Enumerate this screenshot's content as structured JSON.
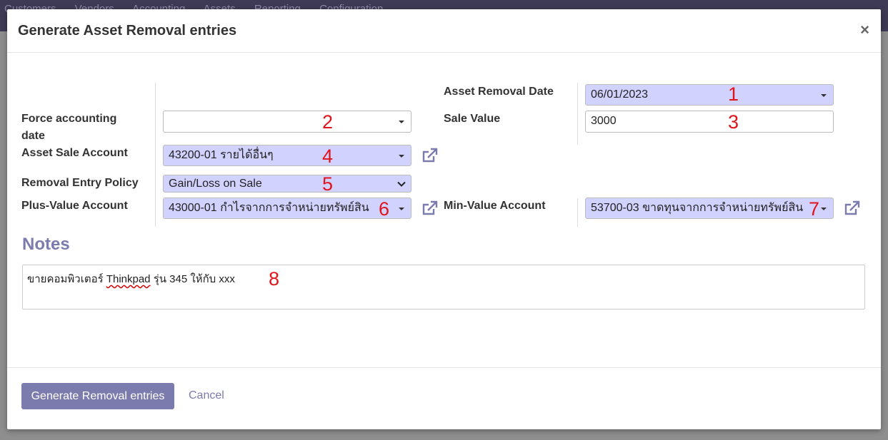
{
  "background": {
    "nav_items": [
      "Customers",
      "Vendors",
      "Accounting",
      "Assets",
      "Reporting",
      "Configuration"
    ]
  },
  "dialog": {
    "title": "Generate Asset Removal entries",
    "close_glyph": "×",
    "fields": {
      "asset_removal_date": {
        "label": "Asset Removal Date",
        "value": "06/01/2023",
        "marker": "1"
      },
      "force_accounting_date": {
        "label": "Force accounting date",
        "value": "",
        "marker": "2"
      },
      "sale_value": {
        "label": "Sale Value",
        "value": "3000",
        "marker": "3"
      },
      "asset_sale_account": {
        "label": "Asset Sale Account",
        "value": "43200-01 รายได้อื่นๆ",
        "marker": "4"
      },
      "removal_entry_policy": {
        "label": "Removal Entry Policy",
        "value": "Gain/Loss on Sale",
        "marker": "5"
      },
      "plus_value_account": {
        "label": "Plus-Value Account",
        "value": "43000-01 กำไรจากการจำหน่ายทรัพย์สิน",
        "marker": "6"
      },
      "min_value_account": {
        "label": "Min-Value Account",
        "value": "53700-03 ขาดทุนจากการจำหน่ายทรัพย์สิน",
        "marker": "7"
      }
    },
    "notes": {
      "title": "Notes",
      "text_before": "ขายคอมพิวเตอร์ ",
      "text_misspelled": "Thinkpad",
      "text_after": " รุ่น 345 ให้กับ xxx",
      "marker": "8"
    },
    "footer": {
      "primary_label": "Generate Removal entries",
      "cancel_label": "Cancel"
    }
  },
  "colors": {
    "accent": "#7c7bad",
    "required_field": "#d2d2ff",
    "marker": "#e0151c",
    "navbar": "#3e3a55"
  }
}
